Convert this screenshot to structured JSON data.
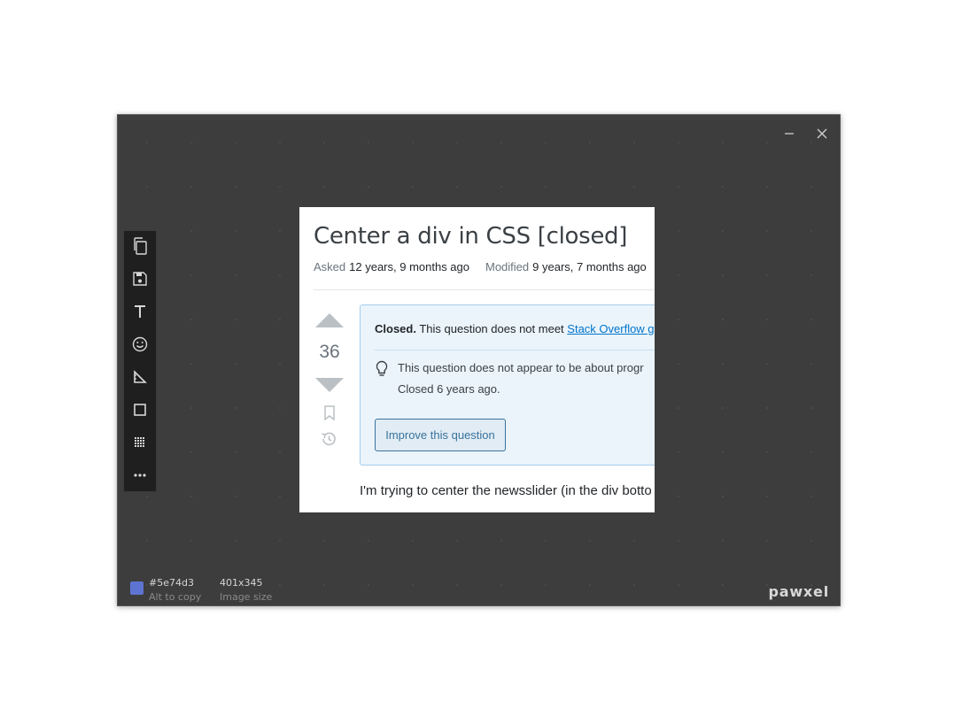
{
  "window": {
    "controls": {
      "minimize_icon": "minimize-icon",
      "close_icon": "close-icon"
    },
    "colors": {
      "background": "#2b2b2b",
      "toolbar": "#1f1f1f"
    }
  },
  "toolbar": {
    "items": [
      {
        "name": "copy",
        "icon": "copy-icon"
      },
      {
        "name": "save",
        "icon": "save-icon"
      },
      {
        "name": "text",
        "icon": "text-icon"
      },
      {
        "name": "emoji",
        "icon": "emoji-icon"
      },
      {
        "name": "ruler",
        "icon": "ruler-icon"
      },
      {
        "name": "rectangle",
        "icon": "rectangle-icon"
      },
      {
        "name": "pixelate",
        "icon": "pixelate-icon"
      },
      {
        "name": "more",
        "icon": "more-icon"
      }
    ]
  },
  "screenshot": {
    "title": "Center a div in CSS [closed]",
    "asked_label": "Asked",
    "asked_value": "12 years, 9 months ago",
    "modified_label": "Modified",
    "modified_value": "9 years, 7 months ago",
    "vote_count": "36",
    "notice": {
      "closed_bold": "Closed.",
      "closed_text": " This question does not meet ",
      "closed_link": "Stack Overflow g",
      "reason": "This question does not appear to be about progr",
      "closed_ago": "Closed 6 years ago.",
      "improve_button": "Improve this question"
    },
    "body_text": "I'm trying to center the newsslider (in the div botto"
  },
  "status": {
    "color_hex": "#5e74d3",
    "color_hint": "Alt to copy",
    "image_size": "401x345",
    "image_size_label": "Image size",
    "brand": "pawxel"
  }
}
